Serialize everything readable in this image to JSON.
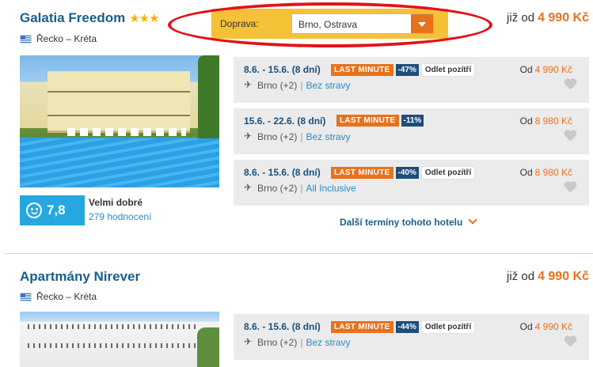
{
  "transport": {
    "label": "Doprava:",
    "value": "Brno, Ostrava"
  },
  "hotels": [
    {
      "name": "Galatia Freedom",
      "stars": "★★★",
      "location": "Řecko – Kréta",
      "price_prefix": "již od",
      "price": "4 990 Kč",
      "rating": {
        "score": "7,8",
        "label": "Velmi dobré",
        "reviews": "279 hodnocení"
      },
      "more_dates": "Další termíny tohoto hotelu",
      "offers": [
        {
          "dates": "8.6. - 15.6. (8 dní)",
          "tag": "LAST MINUTE",
          "discount": "-47%",
          "departure": "Odlet pozítří",
          "airport": "Brno (+2)",
          "meal": "Bez stravy",
          "price_prefix": "Od",
          "price": "4 990 Kč"
        },
        {
          "dates": "15.6. - 22.6. (8 dní)",
          "tag": "LAST MINUTE",
          "discount": "-11%",
          "departure": "",
          "airport": "Brno (+2)",
          "meal": "Bez stravy",
          "price_prefix": "Od",
          "price": "8 980 Kč"
        },
        {
          "dates": "8.6. - 15.6. (8 dní)",
          "tag": "LAST MINUTE",
          "discount": "-40%",
          "departure": "Odlet pozítří",
          "airport": "Brno (+2)",
          "meal": "All Inclusive",
          "price_prefix": "Od",
          "price": "8 980 Kč"
        }
      ]
    },
    {
      "name": "Apartmány Nirever",
      "location": "Řecko – Kréta",
      "price_prefix": "již od",
      "price": "4 990 Kč",
      "offers": [
        {
          "dates": "8.6. - 15.6. (8 dní)",
          "tag": "LAST MINUTE",
          "discount": "-44%",
          "departure": "Odlet pozítří",
          "airport": "Brno (+2)",
          "meal": "Bez stravy",
          "price_prefix": "Od",
          "price": "4 990 Kč"
        }
      ]
    }
  ],
  "colors": {
    "accent_orange": "#e8721c",
    "title_blue": "#1a5f8a",
    "rating_blue": "#25a8e0",
    "filter_yellow": "#f5c136",
    "highlight_red": "#e0141b"
  }
}
